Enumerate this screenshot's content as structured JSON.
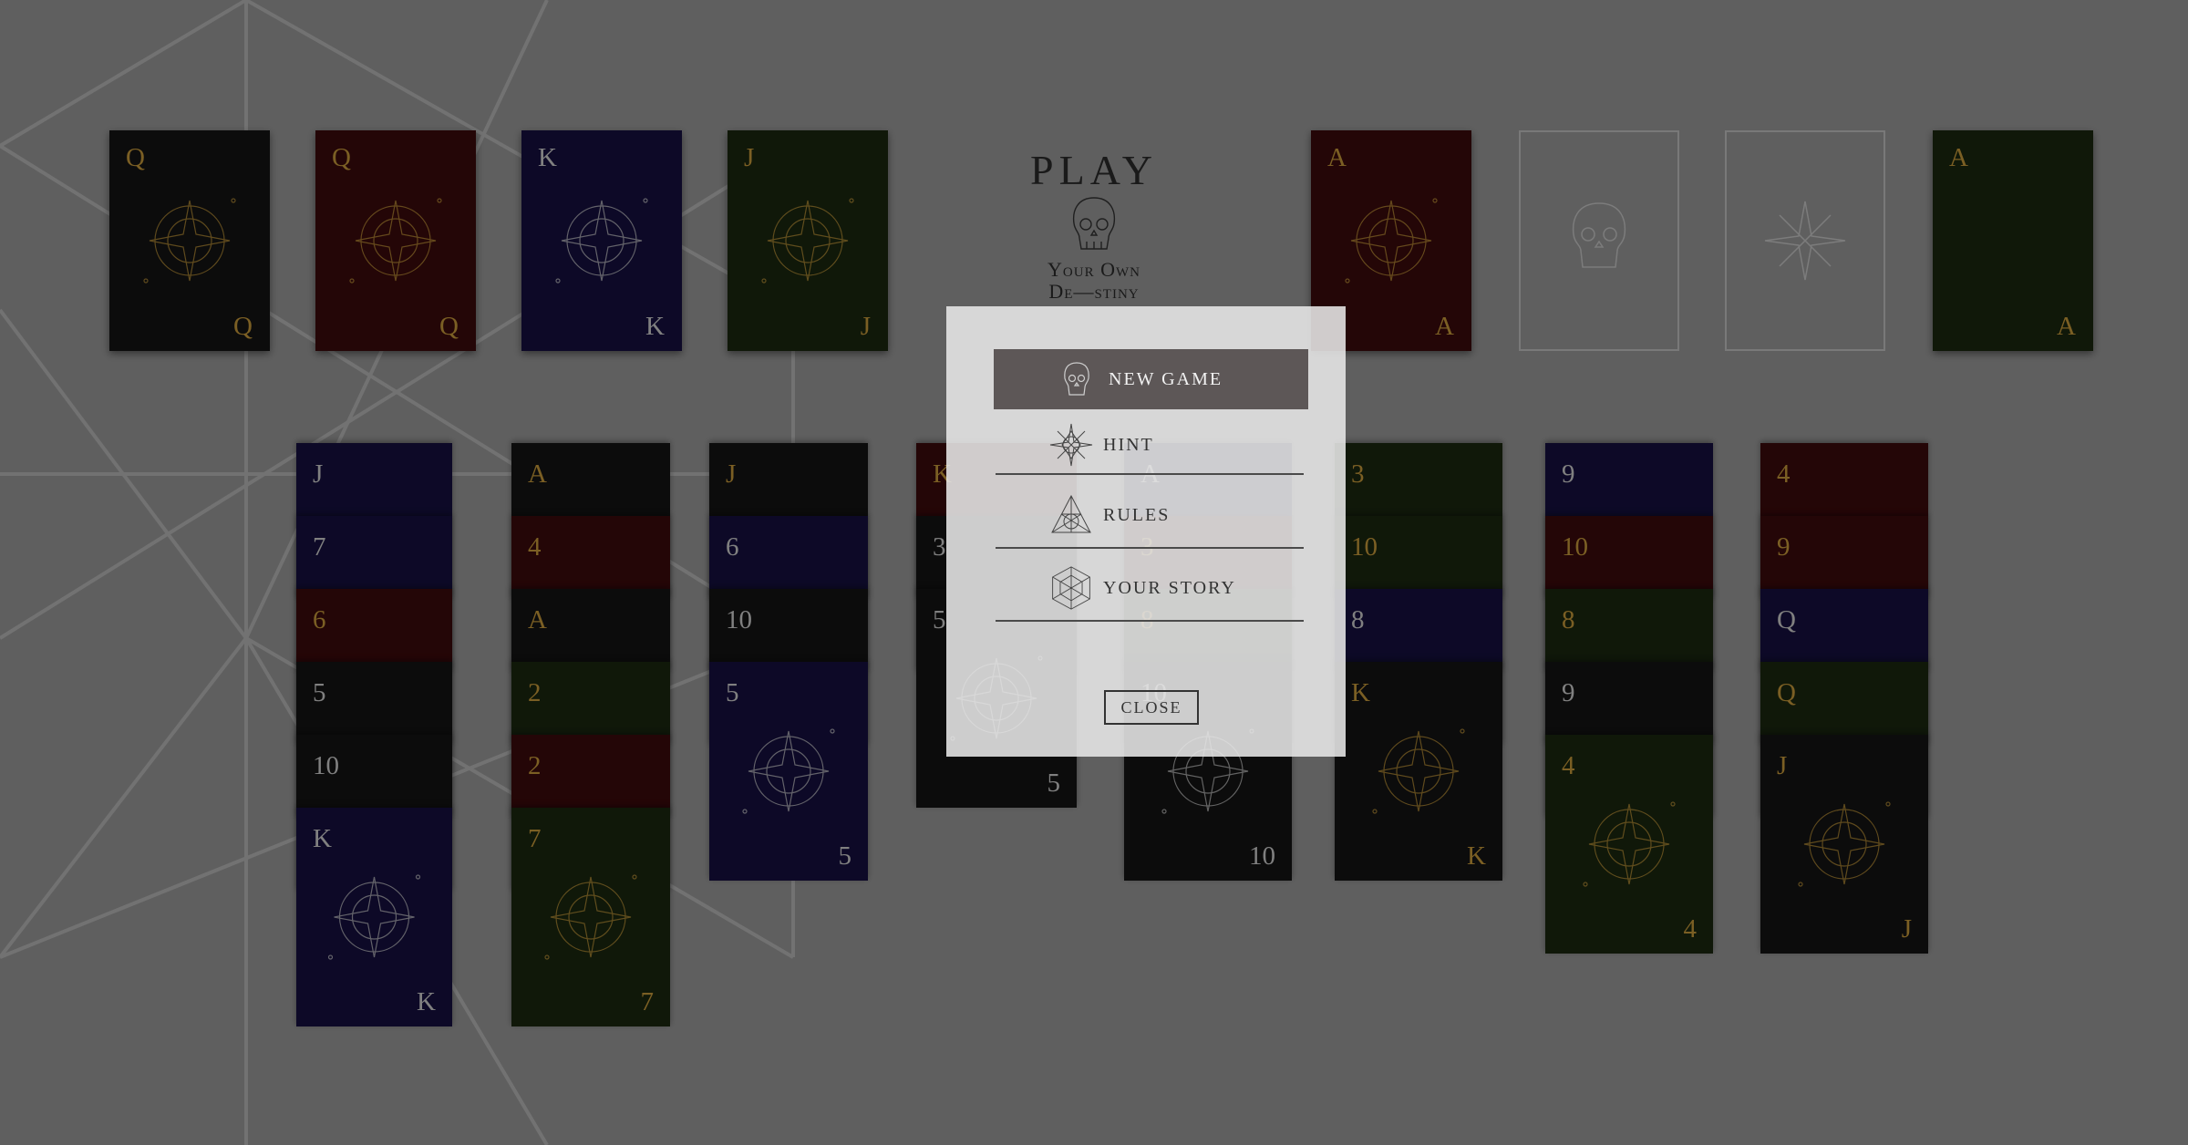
{
  "title": {
    "play": "PLAY",
    "line1": "Your Own",
    "line2": "De—stiny"
  },
  "colors": {
    "black": "#141414",
    "red": "#3b0a0c",
    "blue": "#15103f",
    "green": "#1a2710",
    "gold": "#c79a3a",
    "silver": "#cfcfcf"
  },
  "reserve": [
    {
      "rank": "Q",
      "suit": "black",
      "rank_color": "gold"
    },
    {
      "rank": "Q",
      "suit": "red",
      "rank_color": "gold"
    },
    {
      "rank": "K",
      "suit": "blue",
      "rank_color": "silver"
    },
    {
      "rank": "J",
      "suit": "green",
      "rank_color": "gold"
    }
  ],
  "foundations": [
    {
      "rank": "A",
      "suit": "red",
      "rank_color": "gold",
      "empty": false,
      "icon": "hexagram-icon"
    },
    {
      "rank": "",
      "suit": "",
      "empty": true,
      "icon": "skull-icon"
    },
    {
      "rank": "",
      "suit": "",
      "empty": true,
      "icon": "star-icon"
    },
    {
      "rank": "A",
      "suit": "green",
      "rank_color": "gold",
      "empty": false,
      "icon": ""
    }
  ],
  "tableau": [
    {
      "cards": [
        {
          "rank": "J",
          "suit": "blue",
          "rank_color": "silver"
        },
        {
          "rank": "7",
          "suit": "blue",
          "rank_color": "silver"
        },
        {
          "rank": "6",
          "suit": "red",
          "rank_color": "gold"
        },
        {
          "rank": "5",
          "suit": "black",
          "rank_color": "silver"
        },
        {
          "rank": "10",
          "suit": "black",
          "rank_color": "silver"
        },
        {
          "rank": "K",
          "suit": "blue",
          "rank_color": "silver"
        }
      ]
    },
    {
      "cards": [
        {
          "rank": "A",
          "suit": "black",
          "rank_color": "gold"
        },
        {
          "rank": "4",
          "suit": "red",
          "rank_color": "gold"
        },
        {
          "rank": "A",
          "suit": "black",
          "rank_color": "gold"
        },
        {
          "rank": "2",
          "suit": "green",
          "rank_color": "gold"
        },
        {
          "rank": "2",
          "suit": "red",
          "rank_color": "gold"
        },
        {
          "rank": "7",
          "suit": "green",
          "rank_color": "gold"
        }
      ]
    },
    {
      "cards": [
        {
          "rank": "J",
          "suit": "black",
          "rank_color": "gold"
        },
        {
          "rank": "6",
          "suit": "blue",
          "rank_color": "silver"
        },
        {
          "rank": "10",
          "suit": "black",
          "rank_color": "silver"
        },
        {
          "rank": "5",
          "suit": "blue",
          "rank_color": "silver"
        }
      ]
    },
    {
      "cards": [
        {
          "rank": "K",
          "suit": "red",
          "rank_color": "gold"
        },
        {
          "rank": "3",
          "suit": "black",
          "rank_color": "silver"
        },
        {
          "rank": "5",
          "suit": "black",
          "rank_color": "silver"
        }
      ]
    },
    {
      "cards": [
        {
          "rank": "A",
          "suit": "blue",
          "rank_color": "silver"
        },
        {
          "rank": "3",
          "suit": "red",
          "rank_color": "gold"
        },
        {
          "rank": "8",
          "suit": "green",
          "rank_color": "gold"
        },
        {
          "rank": "10",
          "suit": "black",
          "rank_color": "silver"
        }
      ]
    },
    {
      "cards": [
        {
          "rank": "3",
          "suit": "green",
          "rank_color": "gold"
        },
        {
          "rank": "10",
          "suit": "green",
          "rank_color": "gold"
        },
        {
          "rank": "8",
          "suit": "blue",
          "rank_color": "silver"
        },
        {
          "rank": "K",
          "suit": "black",
          "rank_color": "gold"
        }
      ]
    },
    {
      "cards": [
        {
          "rank": "9",
          "suit": "blue",
          "rank_color": "silver"
        },
        {
          "rank": "10",
          "suit": "red",
          "rank_color": "gold"
        },
        {
          "rank": "8",
          "suit": "green",
          "rank_color": "gold"
        },
        {
          "rank": "9",
          "suit": "black",
          "rank_color": "silver"
        },
        {
          "rank": "4",
          "suit": "green",
          "rank_color": "gold"
        }
      ]
    },
    {
      "cards": [
        {
          "rank": "4",
          "suit": "red",
          "rank_color": "gold"
        },
        {
          "rank": "9",
          "suit": "red",
          "rank_color": "gold"
        },
        {
          "rank": "Q",
          "suit": "blue",
          "rank_color": "silver"
        },
        {
          "rank": "Q",
          "suit": "green",
          "rank_color": "gold"
        },
        {
          "rank": "J",
          "suit": "black",
          "rank_color": "gold"
        }
      ]
    }
  ],
  "menu": {
    "new_game": "NEW GAME",
    "hint": "HINT",
    "rules": "RULES",
    "story": "YOUR STORY",
    "close": "CLOSE"
  }
}
